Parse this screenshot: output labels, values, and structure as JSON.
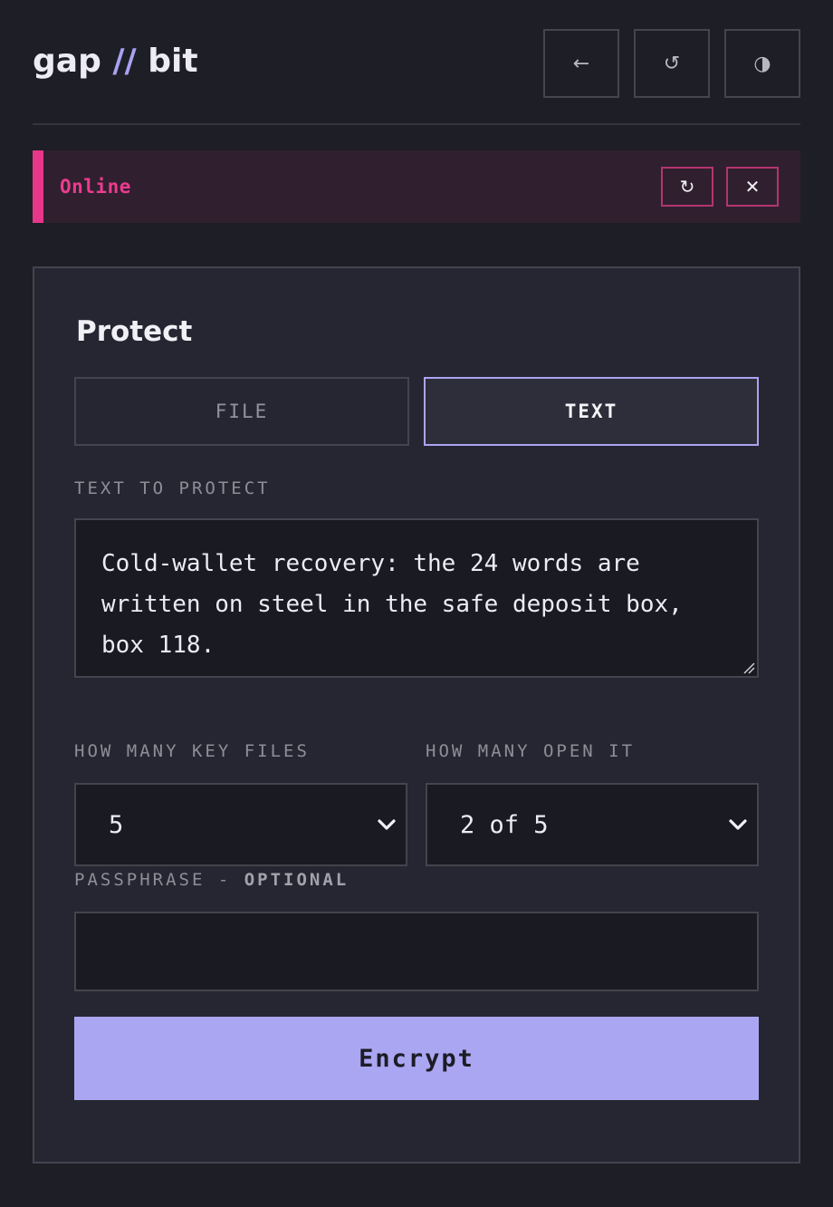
{
  "app": {
    "logo_left": "gap",
    "logo_sep": "//",
    "logo_right": "bit"
  },
  "header": {
    "back_glyph": "←",
    "reset_glyph": "↺",
    "theme_glyph": "◑",
    "icons": [
      "back-arrow-icon",
      "reset-icon",
      "contrast-icon"
    ]
  },
  "status": {
    "text": "Online",
    "refresh_glyph": "↻",
    "close_glyph": "✕",
    "accent": "#e8368a"
  },
  "protect": {
    "title": "Protect",
    "tabs": [
      {
        "label": "FILE",
        "active": false
      },
      {
        "label": "TEXT",
        "active": true
      }
    ],
    "text_label": "TEXT TO PROTECT",
    "text_lines": [
      "Cold-wallet recovery: the 24 words are",
      "written on steel in the safe deposit box,",
      "box 118."
    ],
    "key_files_label": "HOW MANY KEY FILES",
    "key_files_value": "5",
    "open_label": "HOW MANY OPEN IT",
    "open_value": "2 of 5",
    "passphrase_label": "PASSPHRASE - ",
    "passphrase_optional": "OPTIONAL",
    "passphrase_value": "",
    "encrypt_label": "Encrypt"
  },
  "colors": {
    "background": "#1e1e26",
    "card": "#262632",
    "accent_purple": "#aba6f2",
    "accent_pink": "#e8368a"
  }
}
